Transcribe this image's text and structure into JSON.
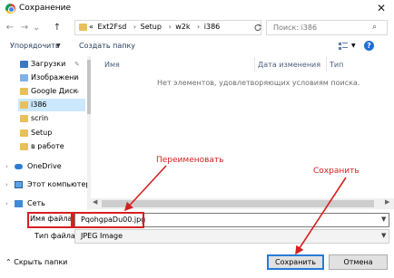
{
  "window": {
    "title": "Сохранение",
    "close_glyph": "✕"
  },
  "nav": {
    "back": "←",
    "forward": "→",
    "up_dropdown": "⌄",
    "up": "↑",
    "breadcrumbs": [
      "«",
      "Ext2Fsd",
      "Setup",
      "w2k",
      "i386"
    ],
    "breadcrumb_sep": "›",
    "search_placeholder": "Поиск: i386"
  },
  "toolbar": {
    "organize": "Упорядочить",
    "new_folder": "Создать папку",
    "help": "?"
  },
  "sidebar": {
    "quick_items": [
      {
        "label": "Загрузки",
        "icon": "download-icon",
        "pinned": true
      },
      {
        "label": "Изображени",
        "icon": "pictures-icon",
        "pinned": true
      },
      {
        "label": "Google Диск",
        "icon": "folder-icon",
        "pinned": true
      },
      {
        "label": "i386",
        "icon": "folder-icon",
        "pinned": false,
        "selected": true
      },
      {
        "label": "scrin",
        "icon": "folder-icon",
        "pinned": false
      },
      {
        "label": "Setup",
        "icon": "folder-icon",
        "pinned": false
      },
      {
        "label": "в работе",
        "icon": "folder-icon",
        "pinned": false
      }
    ],
    "roots": [
      {
        "label": "OneDrive",
        "icon": "cloud-icon"
      },
      {
        "label": "Этот компьютер",
        "icon": "computer-icon"
      },
      {
        "label": "Сеть",
        "icon": "network-icon"
      }
    ]
  },
  "list": {
    "columns": [
      "Имя",
      "Дата изменения",
      "Тип"
    ],
    "empty_message": "Нет элементов, удовлетворяющих условиям поиска."
  },
  "form": {
    "file_name_label": "Имя файла:",
    "file_name_value": "PqohgpaDu00.jpg",
    "file_type_label": "Тип файла:",
    "file_type_value": "JPEG Image",
    "hide_folders": "Скрыть папки",
    "save": "Сохранить",
    "cancel": "Отмена"
  },
  "annotations": {
    "rename": "Переименовать",
    "save": "Сохранить"
  },
  "colors": {
    "accent": "#2a7ad7",
    "annotation": "#d62020",
    "folder": "#e8c05a",
    "selected_row": "#cce8ff"
  }
}
